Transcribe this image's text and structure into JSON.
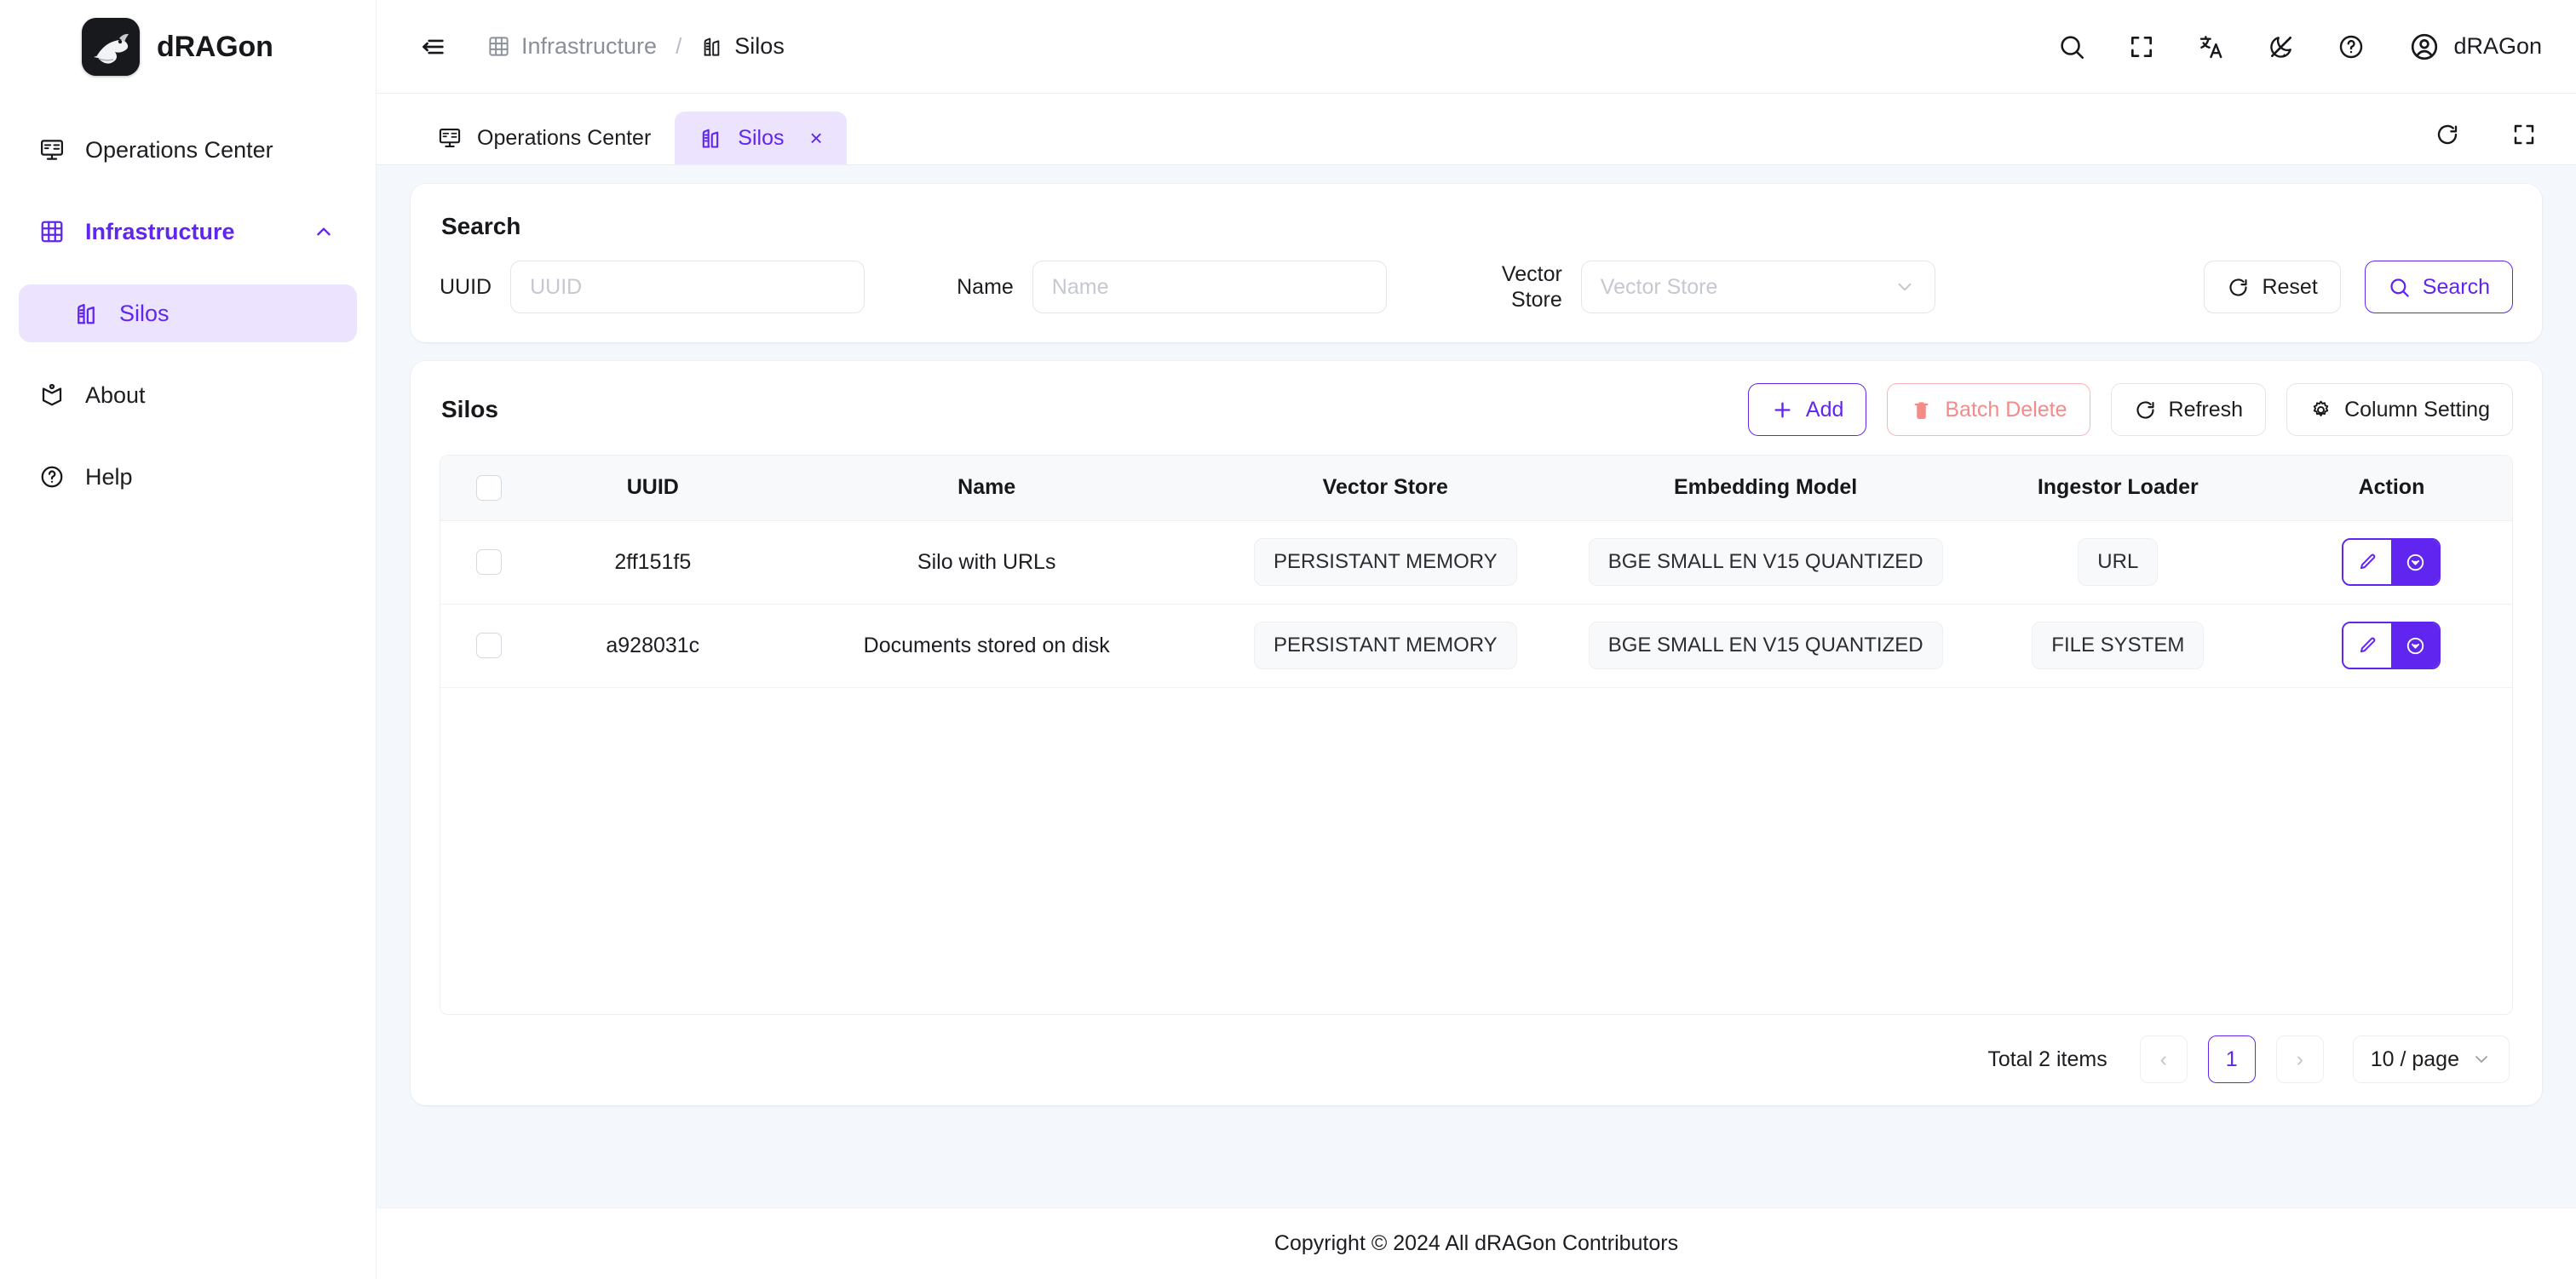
{
  "brand": {
    "name": "dRAGon",
    "logo_icon": "dragon-logo-icon"
  },
  "sidebar": {
    "items": [
      {
        "label": "Operations Center",
        "icon": "monitor-icon"
      },
      {
        "label": "Infrastructure",
        "icon": "grid-icon",
        "chevron": "chevron-up-icon"
      },
      {
        "label": "Silos",
        "icon": "silo-icon"
      },
      {
        "label": "About",
        "icon": "book-icon"
      },
      {
        "label": "Help",
        "icon": "question-circle-icon"
      }
    ]
  },
  "topbar": {
    "collapse_icon": "collapse-sidebar-icon",
    "breadcrumb": [
      {
        "label": "Infrastructure",
        "icon": "grid-icon"
      },
      {
        "label": "Silos",
        "icon": "silo-icon"
      }
    ],
    "separator": "/",
    "icons": [
      "search-icon",
      "fullscreen-icon",
      "translate-icon",
      "theme-toggle-icon",
      "question-circle-icon"
    ],
    "user": {
      "name": "dRAGon",
      "avatar_icon": "user-circle-icon"
    }
  },
  "tabbar": {
    "tabs": [
      {
        "label": "Operations Center",
        "icon": "monitor-icon",
        "active": false,
        "closable": false
      },
      {
        "label": "Silos",
        "icon": "silo-icon",
        "active": true,
        "closable": true,
        "close_label": "×"
      }
    ],
    "right_icons": [
      "refresh-icon",
      "fullscreen-icon"
    ]
  },
  "search": {
    "title": "Search",
    "fields": [
      {
        "label": "UUID",
        "placeholder": "UUID",
        "value": ""
      },
      {
        "label": "Name",
        "placeholder": "Name",
        "value": ""
      }
    ],
    "vector_store": {
      "label_line1": "Vector",
      "label_line2": "Store",
      "placeholder": "Vector Store",
      "value": "",
      "chevron": "chevron-down-icon"
    },
    "reset_label": "Reset",
    "reset_icon": "refresh-icon",
    "search_label": "Search",
    "search_icon": "search-icon"
  },
  "silos": {
    "title": "Silos",
    "actions": {
      "add_label": "Add",
      "add_icon": "plus-icon",
      "batch_delete_label": "Batch Delete",
      "batch_delete_icon": "trash-icon",
      "refresh_label": "Refresh",
      "refresh_icon": "refresh-icon",
      "column_setting_label": "Column Setting",
      "column_setting_icon": "gear-icon"
    },
    "columns": [
      "",
      "UUID",
      "Name",
      "Vector Store",
      "Embedding Model",
      "Ingestor Loader",
      "Action"
    ],
    "rows": [
      {
        "uuid": "2ff151f5",
        "name": "Silo with URLs",
        "vector_store": "PERSISTANT MEMORY",
        "embedding_model": "BGE SMALL EN V15 QUANTIZED",
        "ingestor_loader": "URL",
        "edit_icon": "pencil-icon",
        "more_icon": "chevron-down-circle-icon"
      },
      {
        "uuid": "a928031c",
        "name": "Documents stored on disk",
        "vector_store": "PERSISTANT MEMORY",
        "embedding_model": "BGE SMALL EN V15 QUANTIZED",
        "ingestor_loader": "FILE SYSTEM",
        "edit_icon": "pencil-icon",
        "more_icon": "chevron-down-circle-icon"
      }
    ],
    "pagination": {
      "total_label": "Total 2 items",
      "prev": "‹",
      "pages": [
        "1"
      ],
      "current_page": "1",
      "next": "›",
      "page_size": "10 / page",
      "page_size_chevron": "chevron-down-icon"
    }
  },
  "footer": {
    "text": "Copyright © 2024 All dRAGon Contributors"
  },
  "colors": {
    "accent": "#6125f0",
    "accent_bg": "#ece4fe",
    "danger": "#f48b8b",
    "page_bg": "#f4f7fb",
    "card_bg": "#ffffff",
    "text": "#1c1d21",
    "muted": "#8a8f98"
  }
}
